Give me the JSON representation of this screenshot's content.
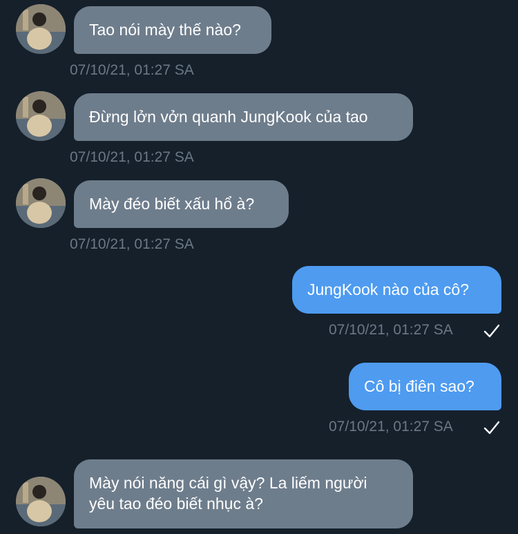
{
  "colors": {
    "background": "#15202b",
    "incoming_bubble": "#6e7d8c",
    "outgoing_bubble": "#4e9bf0",
    "timestamp": "#6b7885",
    "text": "#ffffff"
  },
  "messages": [
    {
      "direction": "incoming",
      "text": "Tao nói mày thế nào?",
      "time": "07/10/21, 01:27 SA"
    },
    {
      "direction": "incoming",
      "text": "Đừng lởn vởn quanh JungKook của tao",
      "time": "07/10/21, 01:27 SA"
    },
    {
      "direction": "incoming",
      "text": "Mày đéo biết xấu hổ à?",
      "time": "07/10/21, 01:27 SA"
    },
    {
      "direction": "outgoing",
      "text": "JungKook nào của cô?",
      "time": "07/10/21, 01:27 SA",
      "status_icon": "checkmark-icon"
    },
    {
      "direction": "outgoing",
      "text": "Cô bị điên sao?",
      "time": "07/10/21, 01:27 SA",
      "status_icon": "checkmark-icon"
    },
    {
      "direction": "incoming",
      "text": "Mày nói năng cái gì vậy? La liếm người\nyêu tao đéo biết nhục à?",
      "time": ""
    }
  ]
}
